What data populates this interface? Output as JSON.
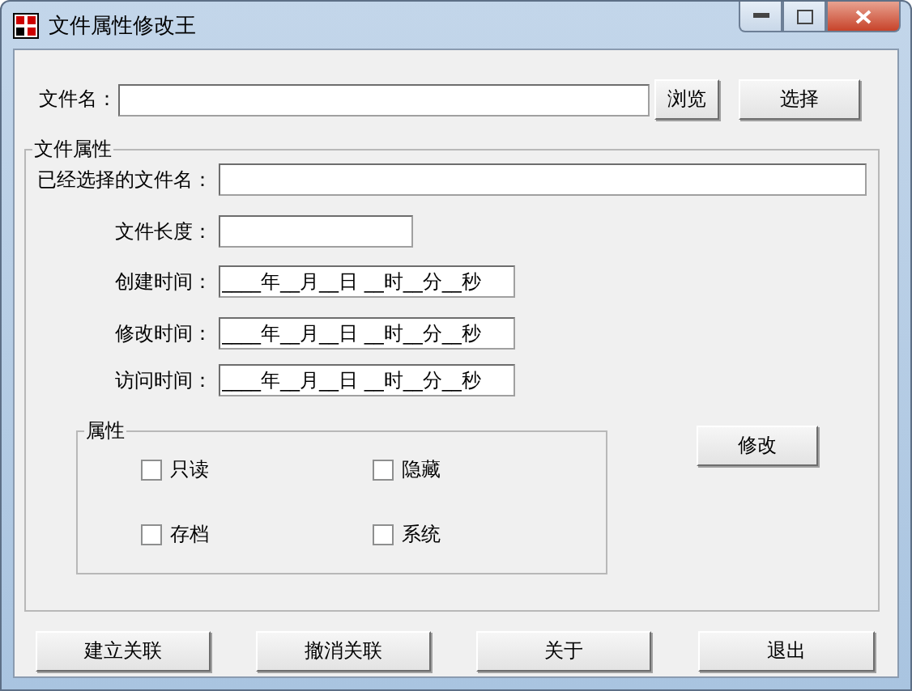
{
  "window": {
    "title": "文件属性修改王"
  },
  "file_name": {
    "label": "文件名："
  },
  "browse_button": "浏览",
  "select_button": "选择",
  "file_group": {
    "title": "文件属性",
    "fields": [
      {
        "label": "已经选择的文件名：",
        "kind": "wide"
      },
      {
        "label": "文件长度：",
        "kind": "short"
      },
      {
        "label": "创建时间：",
        "kind": "time",
        "value": "____年__月__日 __时__分__秒"
      },
      {
        "label": "修改时间：",
        "kind": "time",
        "value": "____年__月__日 __时__分__秒"
      },
      {
        "label": "访问时间：",
        "kind": "time",
        "value": "____年__月__日 __时__分__秒"
      }
    ]
  },
  "attributes": {
    "title": "属性",
    "checkboxes": [
      {
        "label": "只读",
        "checked": false
      },
      {
        "label": "隐藏",
        "checked": false
      },
      {
        "label": "存档",
        "checked": false
      },
      {
        "label": "系统",
        "checked": false
      }
    ]
  },
  "modify_button": "修改",
  "bottom_buttons": [
    "建立关联",
    "撤消关联",
    "关于",
    "退出"
  ]
}
